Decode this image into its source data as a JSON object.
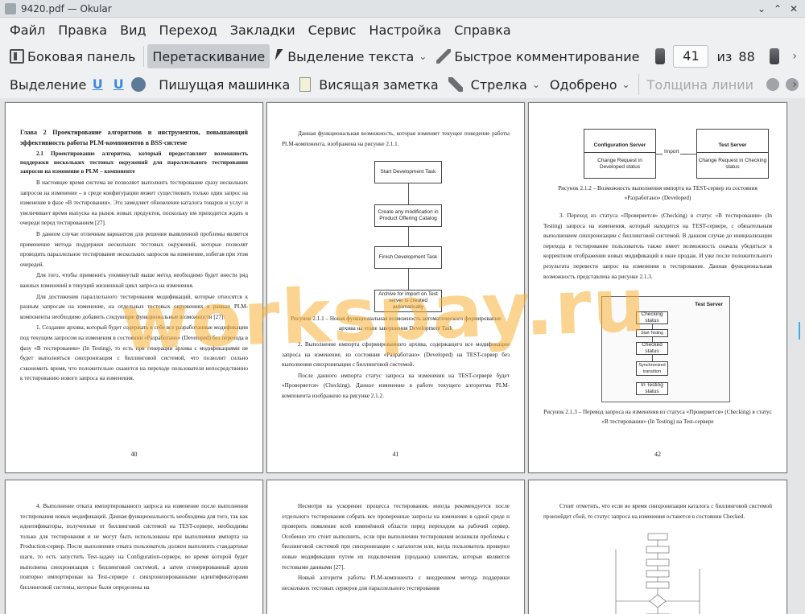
{
  "window": {
    "title": "9420.pdf  — Okular"
  },
  "menu": [
    "Файл",
    "Правка",
    "Вид",
    "Переход",
    "Закладки",
    "Сервис",
    "Настройка",
    "Справка"
  ],
  "toolbar1": {
    "sidebar": "Боковая панель",
    "browse": "Перетаскивание",
    "text_select": "Выделение текста",
    "quick_annot": "Быстрое комментирование",
    "page_current": "41",
    "page_of": "из",
    "page_total": "88"
  },
  "toolbar2": {
    "highlight": "Выделение",
    "typewriter": "Пишущая машинка",
    "popup_note": "Висящая заметка",
    "arrow": "Стрелка",
    "stamp": "Одобрено",
    "line_width": "Толщина линии"
  },
  "watermark": "worksрay.ru",
  "pages": {
    "p40": {
      "heading": "Глава 2 Проектирование алгоритмов и инструментов, повышающий эффективность работы PLM-компонентов в BSS-системе",
      "subheading": "2.1 Проектирование алгоритма, который предоставляет возможность поддержки нескольких тестовых окружений для параллельного тестирования запросов на изменение в PLM – компоненте",
      "paragraphs": [
        "В настоящее время система не позволяет выполнить тестирование сразу нескольких запросов на изменение – в среде конфигурации может существовать только один запрос на изменение в фазе «В тестировании». Это замедляет обновление каталога товаров и услуг и увеличивает время выпуска на рынок новых продуктов, поскольку им приходится ждать в очереди перед тестированием [27].",
        "В данном случае отличным вариантом для решения выявленной проблемы является применение метода поддержки нескольких тестовых окружений, которые позволят проводить параллельное тестирование нескольких запросов на изменение, избегая при этом очередей.",
        "Для того, чтобы применить упомянутый выше метод необходимо будет внести ряд важных изменений в текущий жизненный цикл запроса на изменения.",
        "Для достижения параллельного тестирования модификаций, которые относятся к разным запросам на изменение, на отдельных тестовых окружениях в рамках PLM-компоненты необходимо добавить следующие функциональные возможности [27]:",
        "1. Создание архива, который будет содержать в себе все разработанные модификации под текущим запросом на изменения в состоянии «Разработано» (Developed) без перехода в фазу «В тестировании» (In Testing), то есть при генерации архива с модификациями не будет выполняться синхронизация с биллинговой системой, что позволит сильно сэкономить время, что положительно скажется на переходе пользователя непосредственно к тестированию нового запроса на изменения."
      ],
      "number": "40"
    },
    "p41": {
      "intro": "Данная функциональная возможность, которая изменяет текущее поведение работы PLM-компонента, изображена на рисунке 2.1.1.",
      "flow": [
        "Start Development Task",
        "Create any modification in Product Offering Catalog",
        "Finish Development Task",
        "Archive for import on Test server is created automatically"
      ],
      "caption": "Рисунок 2.1.1 – Новая функциональная возможность автоматического формирования архива на этапе завершения Development Task",
      "paragraphs": [
        "2. Выполнение импорта сформированного архива, содержащего все модификации запроса на изменение, из состояния «Разработано» (Developed) на TEST-сервер без выполнения синхронизации с биллинговой системой.",
        "После данного импорта статус запроса на изменения на TEST-сервере будет «Проверяется» (Checking). Данное изменение в работе текущего алгоритма PLM-компонента изображено на рисунке 2.1.2."
      ],
      "number": "41"
    },
    "p42": {
      "diagram": {
        "left_title": "Configuration Server",
        "left_body": "Change Request in Developed status",
        "link": "Import",
        "right_title": "Test Server",
        "right_body": "Change Request in Checking status"
      },
      "caption1": "Рисунок 2.1.2 – Возможность выполнения импорта на TEST-сервер из состояния «Разработано» (Developed)",
      "paragraphs": [
        "3. Переход из статуса «Проверяется» (Checking) в статус «В тестировании» (In Testing) запроса на изменения, который находится на TEST-сервере, с обязательным выполнением синхронизации с биллинговой системой. В данном случае до инициализации перехода в тестирование пользователь также имеет возможность сначала убедиться в корректном отображении новых модификаций в окне продаж. И уже после положительного результата перевести запрос на изменения в тестирование. Данная функциональная возможность представлена на рисунке 2.1.3."
      ],
      "test_server": "Test Server",
      "states": [
        "Checking status",
        "Start Testing",
        "Checked status",
        "Synchronized transition",
        "In Testing status"
      ],
      "caption2": "Рисунок 2.1.3 – Перевод запроса на изменения из статуса «Проверяется» (Checking) в статус «В тестировании» (In Testing) на Test-сервере",
      "number": "42"
    },
    "p43": {
      "paragraphs": [
        "4. Выполнение отката импортированного запроса на изменение после выполнения тестирования новых модификаций. Данная функциональность необходима для того, так как идентификаторы, полученные от биллинговой системой на TEST-сервере, необходимы только для тестирования и не могут быть использованы при выполнении импорта на Production-сервер. После выполнения отката пользователь должен выполнить стандартные шаги, то есть запустить Test-задачу на Configuration-сервере, во время которой будет выполнена синхронизация с биллинговой системой, а затем сгенерированный архив повторно импортирован на Test-сервере с синхронизированными идентификаторами биллинговой системы, которые были определены на"
      ]
    },
    "p44": {
      "paragraphs": [
        "Несмотря на ускорение процесса тестирования, иногда рекомендуется после отдельного тестирования собрать все проверенные запросы на изменение в одной среде и проверить появление всей изменённой области перед переходом на рабочий сервер. Особенно это стоит выполнить, если при выполнении тестирования возникли проблемы с биллинговой системой при синхронизации с каталогом или, когда пользователь проверил новые модификации путем их подключения (продажи) клиентам, которые являются тестовыми данными [27].",
        "Новый алгоритм работы PLM-компонента с внедрением метода поддержки нескольких тестовых серверов для параллельного тестирования"
      ]
    },
    "p45": {
      "paragraphs": [
        "Стоит отметить, что если во время синхронизации каталога с биллинговой системой произойдет сбой, то статус запроса на изменения останется в состоянии Checked."
      ]
    }
  }
}
